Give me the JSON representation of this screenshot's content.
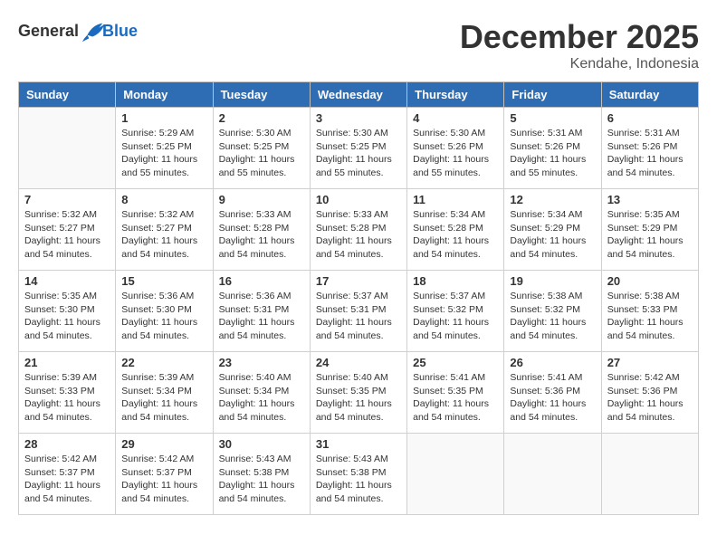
{
  "header": {
    "logo_general": "General",
    "logo_blue": "Blue",
    "month_year": "December 2025",
    "location": "Kendahe, Indonesia"
  },
  "weekdays": [
    "Sunday",
    "Monday",
    "Tuesday",
    "Wednesday",
    "Thursday",
    "Friday",
    "Saturday"
  ],
  "weeks": [
    [
      {
        "day": "",
        "info": ""
      },
      {
        "day": "1",
        "info": "Sunrise: 5:29 AM\nSunset: 5:25 PM\nDaylight: 11 hours\nand 55 minutes."
      },
      {
        "day": "2",
        "info": "Sunrise: 5:30 AM\nSunset: 5:25 PM\nDaylight: 11 hours\nand 55 minutes."
      },
      {
        "day": "3",
        "info": "Sunrise: 5:30 AM\nSunset: 5:25 PM\nDaylight: 11 hours\nand 55 minutes."
      },
      {
        "day": "4",
        "info": "Sunrise: 5:30 AM\nSunset: 5:26 PM\nDaylight: 11 hours\nand 55 minutes."
      },
      {
        "day": "5",
        "info": "Sunrise: 5:31 AM\nSunset: 5:26 PM\nDaylight: 11 hours\nand 55 minutes."
      },
      {
        "day": "6",
        "info": "Sunrise: 5:31 AM\nSunset: 5:26 PM\nDaylight: 11 hours\nand 54 minutes."
      }
    ],
    [
      {
        "day": "7",
        "info": "Sunrise: 5:32 AM\nSunset: 5:27 PM\nDaylight: 11 hours\nand 54 minutes."
      },
      {
        "day": "8",
        "info": "Sunrise: 5:32 AM\nSunset: 5:27 PM\nDaylight: 11 hours\nand 54 minutes."
      },
      {
        "day": "9",
        "info": "Sunrise: 5:33 AM\nSunset: 5:28 PM\nDaylight: 11 hours\nand 54 minutes."
      },
      {
        "day": "10",
        "info": "Sunrise: 5:33 AM\nSunset: 5:28 PM\nDaylight: 11 hours\nand 54 minutes."
      },
      {
        "day": "11",
        "info": "Sunrise: 5:34 AM\nSunset: 5:28 PM\nDaylight: 11 hours\nand 54 minutes."
      },
      {
        "day": "12",
        "info": "Sunrise: 5:34 AM\nSunset: 5:29 PM\nDaylight: 11 hours\nand 54 minutes."
      },
      {
        "day": "13",
        "info": "Sunrise: 5:35 AM\nSunset: 5:29 PM\nDaylight: 11 hours\nand 54 minutes."
      }
    ],
    [
      {
        "day": "14",
        "info": "Sunrise: 5:35 AM\nSunset: 5:30 PM\nDaylight: 11 hours\nand 54 minutes."
      },
      {
        "day": "15",
        "info": "Sunrise: 5:36 AM\nSunset: 5:30 PM\nDaylight: 11 hours\nand 54 minutes."
      },
      {
        "day": "16",
        "info": "Sunrise: 5:36 AM\nSunset: 5:31 PM\nDaylight: 11 hours\nand 54 minutes."
      },
      {
        "day": "17",
        "info": "Sunrise: 5:37 AM\nSunset: 5:31 PM\nDaylight: 11 hours\nand 54 minutes."
      },
      {
        "day": "18",
        "info": "Sunrise: 5:37 AM\nSunset: 5:32 PM\nDaylight: 11 hours\nand 54 minutes."
      },
      {
        "day": "19",
        "info": "Sunrise: 5:38 AM\nSunset: 5:32 PM\nDaylight: 11 hours\nand 54 minutes."
      },
      {
        "day": "20",
        "info": "Sunrise: 5:38 AM\nSunset: 5:33 PM\nDaylight: 11 hours\nand 54 minutes."
      }
    ],
    [
      {
        "day": "21",
        "info": "Sunrise: 5:39 AM\nSunset: 5:33 PM\nDaylight: 11 hours\nand 54 minutes."
      },
      {
        "day": "22",
        "info": "Sunrise: 5:39 AM\nSunset: 5:34 PM\nDaylight: 11 hours\nand 54 minutes."
      },
      {
        "day": "23",
        "info": "Sunrise: 5:40 AM\nSunset: 5:34 PM\nDaylight: 11 hours\nand 54 minutes."
      },
      {
        "day": "24",
        "info": "Sunrise: 5:40 AM\nSunset: 5:35 PM\nDaylight: 11 hours\nand 54 minutes."
      },
      {
        "day": "25",
        "info": "Sunrise: 5:41 AM\nSunset: 5:35 PM\nDaylight: 11 hours\nand 54 minutes."
      },
      {
        "day": "26",
        "info": "Sunrise: 5:41 AM\nSunset: 5:36 PM\nDaylight: 11 hours\nand 54 minutes."
      },
      {
        "day": "27",
        "info": "Sunrise: 5:42 AM\nSunset: 5:36 PM\nDaylight: 11 hours\nand 54 minutes."
      }
    ],
    [
      {
        "day": "28",
        "info": "Sunrise: 5:42 AM\nSunset: 5:37 PM\nDaylight: 11 hours\nand 54 minutes."
      },
      {
        "day": "29",
        "info": "Sunrise: 5:42 AM\nSunset: 5:37 PM\nDaylight: 11 hours\nand 54 minutes."
      },
      {
        "day": "30",
        "info": "Sunrise: 5:43 AM\nSunset: 5:38 PM\nDaylight: 11 hours\nand 54 minutes."
      },
      {
        "day": "31",
        "info": "Sunrise: 5:43 AM\nSunset: 5:38 PM\nDaylight: 11 hours\nand 54 minutes."
      },
      {
        "day": "",
        "info": ""
      },
      {
        "day": "",
        "info": ""
      },
      {
        "day": "",
        "info": ""
      }
    ]
  ]
}
